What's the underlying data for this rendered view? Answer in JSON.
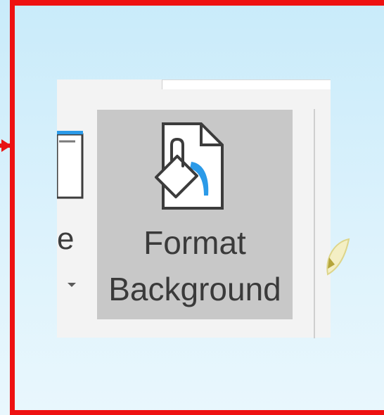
{
  "ribbon": {
    "partial_button": {
      "label_tail": "e",
      "has_dropdown": true
    },
    "format_background": {
      "label_line1": "Format",
      "label_line2": "Background",
      "icon": "format-background-icon",
      "state": "hovered"
    }
  },
  "annotation": {
    "highlight_color": "#ee1111"
  },
  "colors": {
    "ribbon_bg": "#f3f3f3",
    "button_hover": "#c8c8c8",
    "accent_blue": "#2b9ae8"
  }
}
